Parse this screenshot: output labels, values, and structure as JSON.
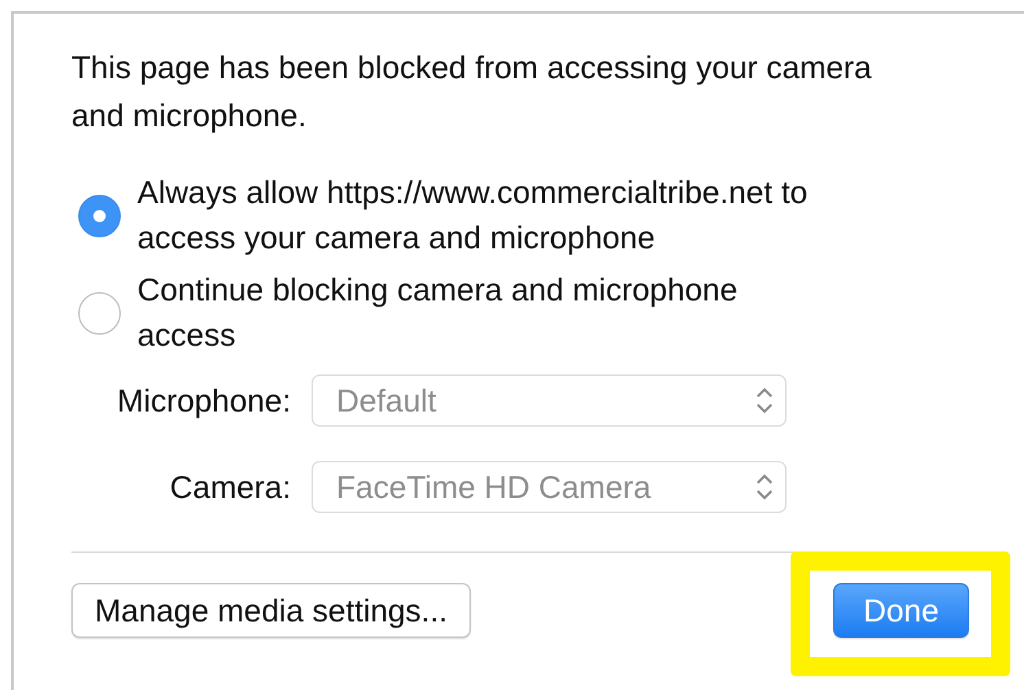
{
  "message": "This page has been blocked from accessing your camera and microphone.",
  "options": [
    {
      "label": "Always allow https://www.commercialtribe.net to access your camera and microphone",
      "selected": true
    },
    {
      "label": "Continue blocking camera and microphone access",
      "selected": false
    }
  ],
  "devices": [
    {
      "label": "Microphone:",
      "value": "Default",
      "disabled": true
    },
    {
      "label": "Camera:",
      "value": "FaceTime HD Camera",
      "disabled": true
    }
  ],
  "buttons": [
    {
      "label": "Manage media settings...",
      "kind": "secondary",
      "highlighted": false
    },
    {
      "label": "Done",
      "kind": "default",
      "highlighted": true
    }
  ]
}
